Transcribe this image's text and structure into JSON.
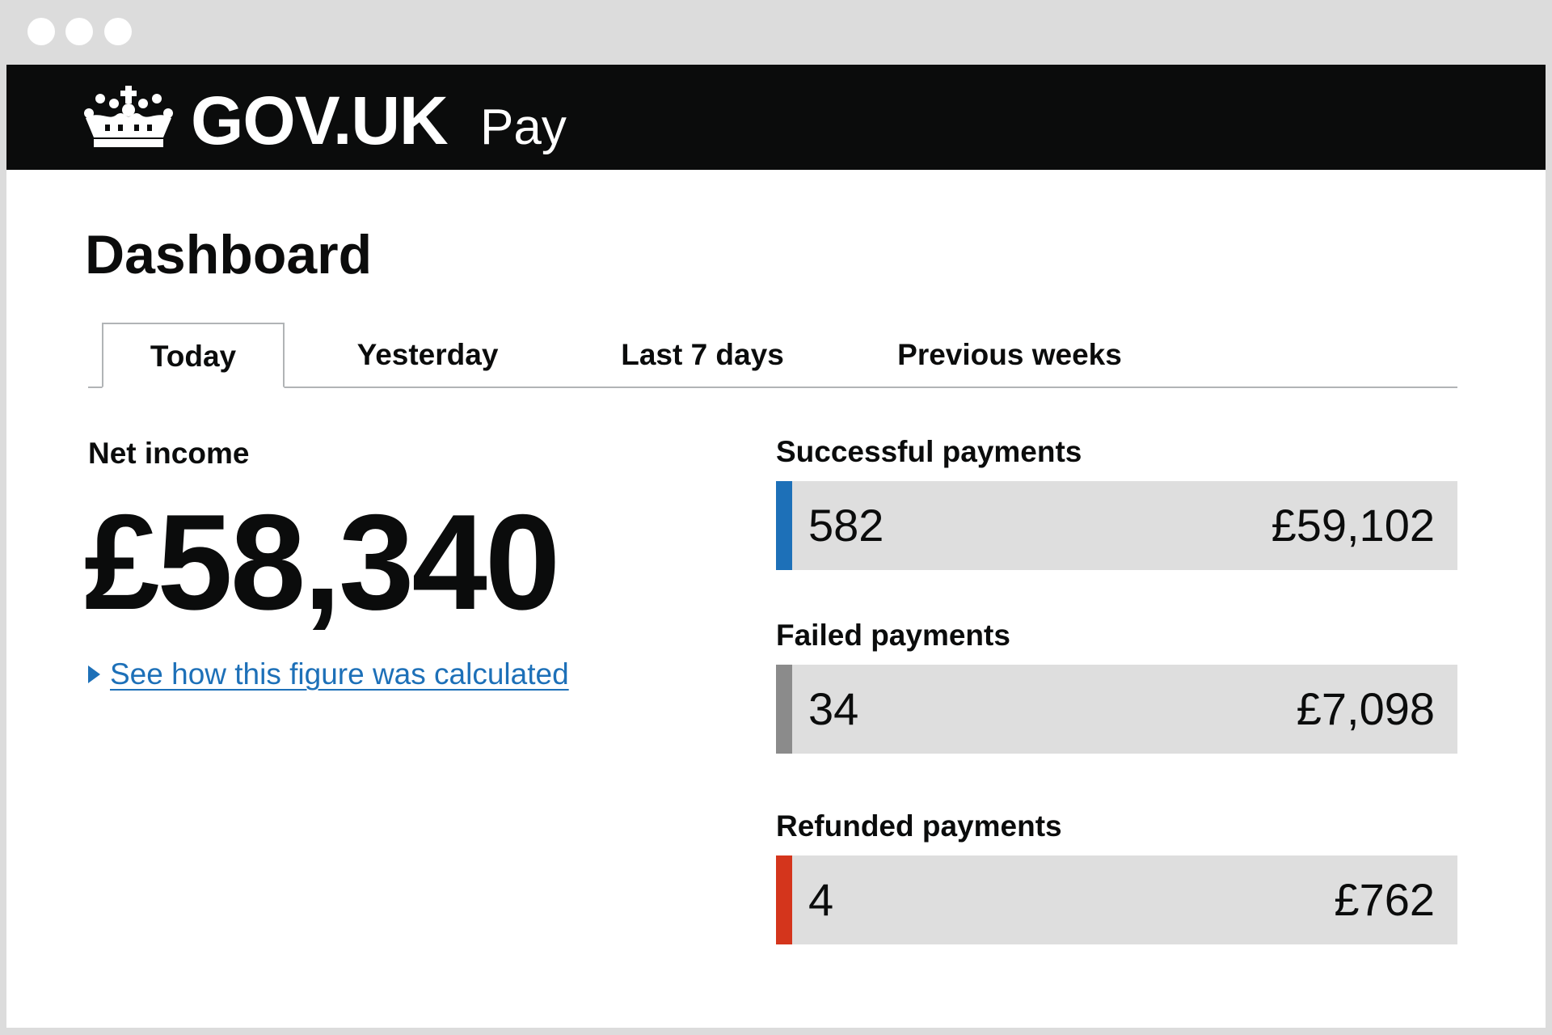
{
  "window": {
    "controls": [
      "dot",
      "dot",
      "dot"
    ]
  },
  "header": {
    "logo_icon": "crown-icon",
    "logotype": "GOV.UK",
    "service_name": "Pay",
    "background": "#0b0c0c"
  },
  "page": {
    "title": "Dashboard"
  },
  "tabs": [
    {
      "label": "Today",
      "selected": true
    },
    {
      "label": "Yesterday",
      "selected": false
    },
    {
      "label": "Last 7 days",
      "selected": false
    },
    {
      "label": "Previous weeks",
      "selected": false
    }
  ],
  "net_income": {
    "label": "Net income",
    "value": "£58,340",
    "details_link": "See how this figure was calculated",
    "details_icon": "triangle-right-icon"
  },
  "stats": [
    {
      "label": "Successful payments",
      "count": "582",
      "amount": "£59,102",
      "color": "#1d70b8"
    },
    {
      "label": "Failed payments",
      "count": "34",
      "amount": "£7,098",
      "color": "#8b8b8b"
    },
    {
      "label": "Refunded payments",
      "count": "4",
      "amount": "£762",
      "color": "#d4351c"
    }
  ],
  "colors": {
    "link": "#1d70b8",
    "panel": "#dedede",
    "frame": "#dcdcdc"
  }
}
